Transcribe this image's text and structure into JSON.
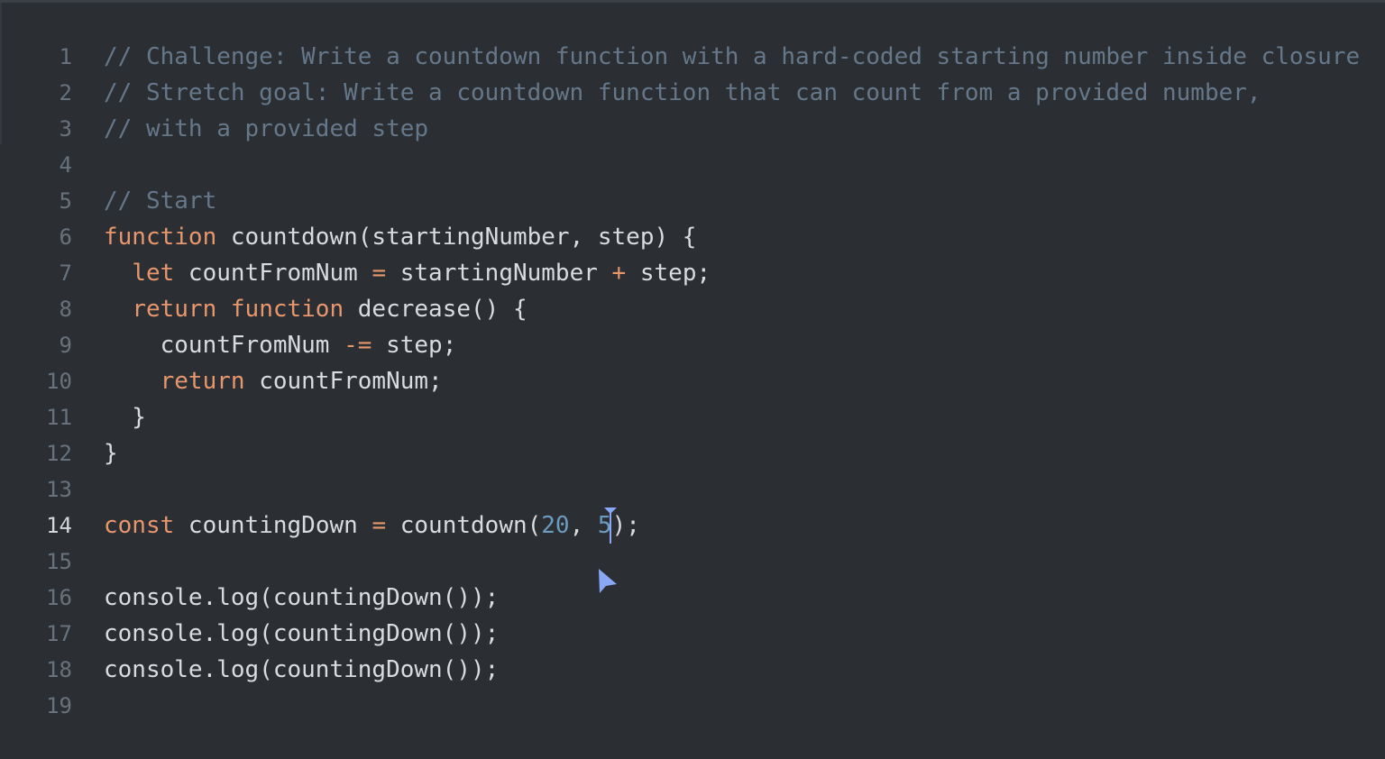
{
  "editor": {
    "active_line": 14,
    "caret_color": "#8aa7f5",
    "lines": [
      {
        "num": "1",
        "tokens": [
          [
            "comment",
            "// Challenge: Write a countdown function with a hard-coded starting number inside closure"
          ]
        ]
      },
      {
        "num": "2",
        "tokens": [
          [
            "comment",
            "// Stretch goal: Write a countdown function that can count from a provided number,"
          ]
        ]
      },
      {
        "num": "3",
        "tokens": [
          [
            "comment",
            "// with a provided step"
          ]
        ]
      },
      {
        "num": "4",
        "tokens": []
      },
      {
        "num": "5",
        "tokens": [
          [
            "comment",
            "// Start"
          ]
        ]
      },
      {
        "num": "6",
        "tokens": [
          [
            "kw",
            "function"
          ],
          [
            "text",
            " countdown(startingNumber, step) {"
          ]
        ]
      },
      {
        "num": "7",
        "tokens": [
          [
            "text",
            "  "
          ],
          [
            "kw",
            "let"
          ],
          [
            "text",
            " countFromNum "
          ],
          [
            "op",
            "="
          ],
          [
            "text",
            " startingNumber "
          ],
          [
            "op",
            "+"
          ],
          [
            "text",
            " step;"
          ]
        ]
      },
      {
        "num": "8",
        "tokens": [
          [
            "text",
            "  "
          ],
          [
            "kw",
            "return"
          ],
          [
            "text",
            " "
          ],
          [
            "kw",
            "function"
          ],
          [
            "text",
            " decrease() {"
          ]
        ]
      },
      {
        "num": "9",
        "tokens": [
          [
            "text",
            "    countFromNum "
          ],
          [
            "op",
            "-="
          ],
          [
            "text",
            " step;"
          ]
        ]
      },
      {
        "num": "10",
        "tokens": [
          [
            "text",
            "    "
          ],
          [
            "kw",
            "return"
          ],
          [
            "text",
            " countFromNum;"
          ]
        ]
      },
      {
        "num": "11",
        "tokens": [
          [
            "text",
            "  }"
          ]
        ]
      },
      {
        "num": "12",
        "tokens": [
          [
            "text",
            "}"
          ]
        ]
      },
      {
        "num": "13",
        "tokens": []
      },
      {
        "num": "14",
        "tokens": [
          [
            "kw",
            "const"
          ],
          [
            "text",
            " countingDown "
          ],
          [
            "op",
            "="
          ],
          [
            "text",
            " countdown("
          ],
          [
            "num",
            "20"
          ],
          [
            "text",
            ", "
          ],
          [
            "num",
            "5"
          ],
          [
            "text",
            ");"
          ]
        ]
      },
      {
        "num": "15",
        "tokens": []
      },
      {
        "num": "16",
        "tokens": [
          [
            "text",
            "console.log(countingDown());"
          ]
        ]
      },
      {
        "num": "17",
        "tokens": [
          [
            "text",
            "console.log(countingDown());"
          ]
        ]
      },
      {
        "num": "18",
        "tokens": [
          [
            "text",
            "console.log(countingDown());"
          ]
        ]
      },
      {
        "num": "19",
        "tokens": []
      }
    ]
  }
}
